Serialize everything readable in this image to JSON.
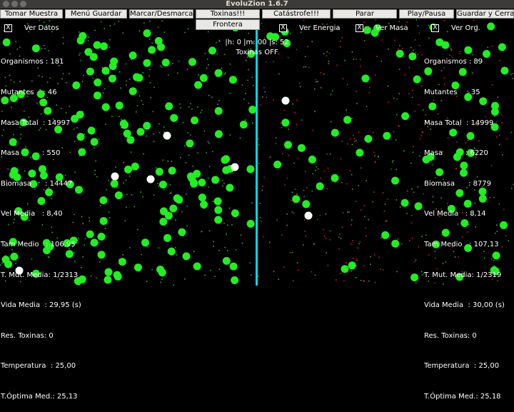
{
  "window": {
    "title": "EvoluZion 1.6.7"
  },
  "toolbar": {
    "take_sample": "Tomar Muestra",
    "save_menu": "Menú Guardar",
    "mark_unmark": "Marcar/Desmarcar",
    "toxins": "Toxinas!!!",
    "catastrophe": "Catástrofe!!!",
    "stop": "Parar",
    "play_pause": "Play/Pausa",
    "save_close": "Guardar y Cerrar",
    "border": "Frontera"
  },
  "options": {
    "see_data": {
      "mark": "X",
      "label": "Ver Datos"
    },
    "see_energy": {
      "mark": "X",
      "label": "Ver Energia"
    },
    "see_mass": {
      "mark": "X",
      "label": "Ver Masa"
    },
    "see_org": {
      "mark": "X",
      "label": "Ver Org."
    }
  },
  "hud": {
    "time": "|h: 0 |m: 00 |s: 52",
    "toxins": "Toxinas OFF"
  },
  "left_stats": [
    "Organismos : 181",
    "Mutantes    : 46",
    "Masa Total  : 14997",
    "Masa          : 550",
    "Biomasa      : 14447",
    "Vel Media   : 8,40",
    "Tam Medio   : 106,95",
    "T. Mut. Media: 1/2313",
    "Vida Media  : 29,95 (s)",
    "Res. Toxinas: 0",
    "Temperatura  : 25,00",
    "T.Óptima Med.: 25,13"
  ],
  "right_stats": [
    "Organismos : 89",
    "Mutantes    : 35",
    "Masa Total  : 14999",
    "Masa          : 6220",
    "Biomasa      : 8779",
    "Vel Media   : 8,14",
    "Tam Medio   : 107,13",
    "T. Mut. Media: 1/2319",
    "Vida Media  : 30,00 (s)",
    "Res. Toxinas: 0",
    "Temperatura  : 25,00",
    "T.Óptima Med.: 25,18"
  ],
  "colors": {
    "organism": "#22ee22",
    "marked": "#ffffff",
    "divider": "#00d8e8",
    "food_green": "#3fa33f",
    "food_red": "#cc2222"
  }
}
